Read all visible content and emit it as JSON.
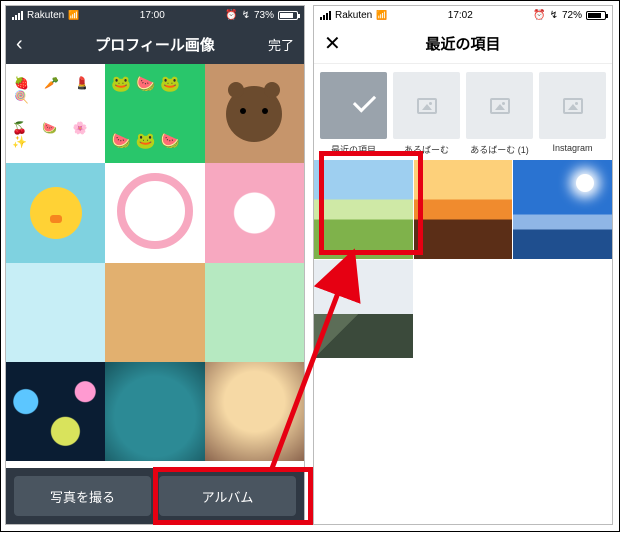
{
  "left": {
    "status": {
      "carrier": "Rakuten",
      "time": "17:00",
      "alarm_icon": "alarm",
      "battery": "73%"
    },
    "nav": {
      "back_icon": "chevron-left",
      "title": "プロフィール画像",
      "done": "完了"
    },
    "buttons": {
      "take_photo": "写真を撮る",
      "album": "アルバム"
    }
  },
  "right": {
    "status": {
      "carrier": "Rakuten",
      "time": "17:02",
      "alarm_icon": "alarm",
      "battery": "72%"
    },
    "nav": {
      "close_icon": "close",
      "title": "最近の項目"
    },
    "albums": [
      {
        "label": "最近の項目",
        "selected": true
      },
      {
        "label": "あるばーむ",
        "selected": false
      },
      {
        "label": "あるばーむ (1)",
        "selected": false
      },
      {
        "label": "Instagram",
        "selected": false
      }
    ]
  },
  "annotation": {
    "highlight_left": "album-button",
    "highlight_right": "first-photo",
    "arrow": "from-album-button-to-first-photo"
  }
}
